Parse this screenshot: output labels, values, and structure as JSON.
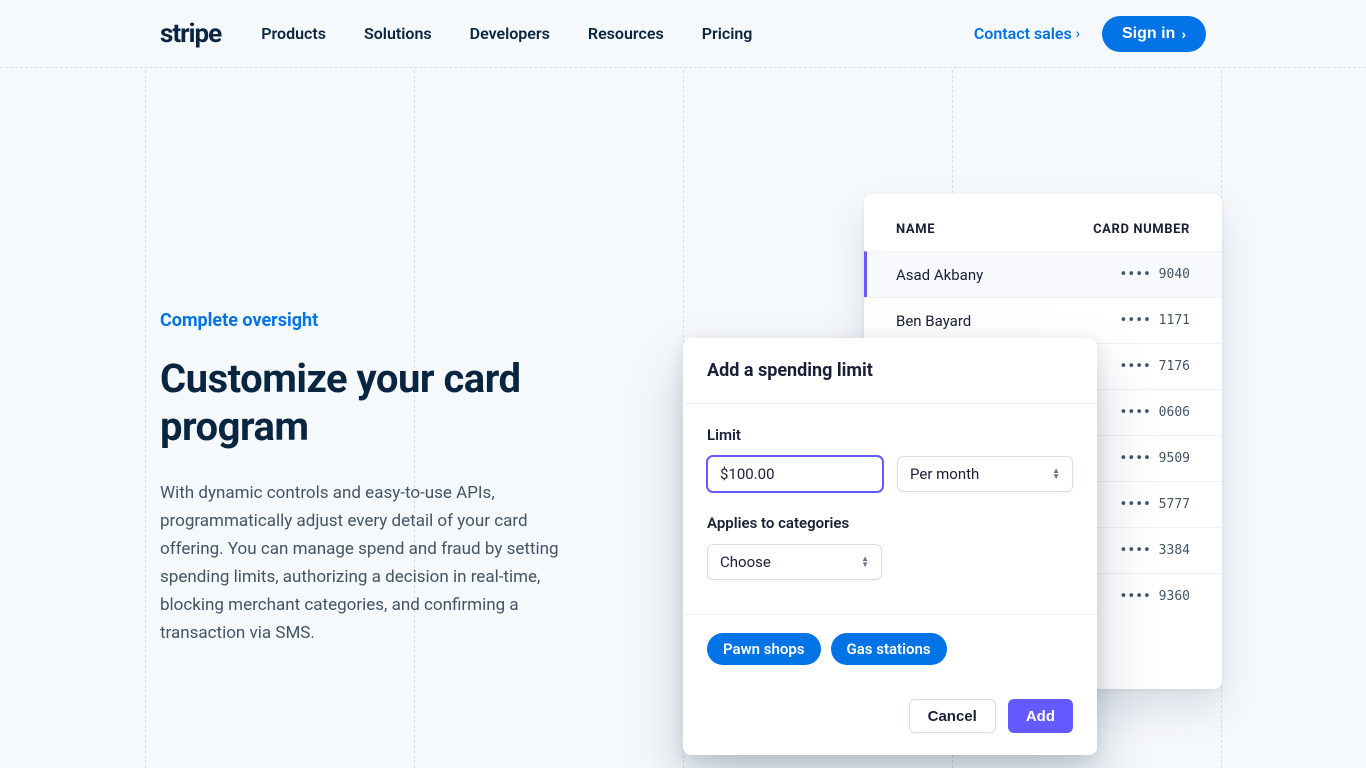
{
  "header": {
    "logo": "stripe",
    "nav": [
      "Products",
      "Solutions",
      "Developers",
      "Resources",
      "Pricing"
    ],
    "contact_sales": "Contact sales",
    "sign_in": "Sign in"
  },
  "content": {
    "eyebrow": "Complete oversight",
    "title": "Customize your card program",
    "body": "With dynamic controls and easy-to-use APIs, programmatically adjust every detail of your card offering. You can manage spend and fraud by setting spending limits, authorizing a decision in real-time, blocking merchant categories, and confirming a transaction via SMS."
  },
  "card_list": {
    "col_name": "NAME",
    "col_number": "CARD NUMBER",
    "rows": [
      {
        "name": "Asad Akbany",
        "num": "•••• 9040",
        "selected": true
      },
      {
        "name": "Ben Bayard",
        "num": "•••• 1171"
      },
      {
        "name": "",
        "num": "•••• 7176"
      },
      {
        "name": "",
        "num": "•••• 0606"
      },
      {
        "name": "",
        "num": "•••• 9509"
      },
      {
        "name": "",
        "num": "•••• 5777"
      },
      {
        "name": "",
        "num": "•••• 3384"
      },
      {
        "name": "",
        "num": "•••• 9360"
      }
    ]
  },
  "modal": {
    "title": "Add a spending limit",
    "limit_label": "Limit",
    "limit_value": "$100.00",
    "period_value": "Per month",
    "categories_label": "Applies to categories",
    "categories_value": "Choose",
    "chips": [
      "Pawn shops",
      "Gas stations"
    ],
    "cancel": "Cancel",
    "add": "Add"
  }
}
